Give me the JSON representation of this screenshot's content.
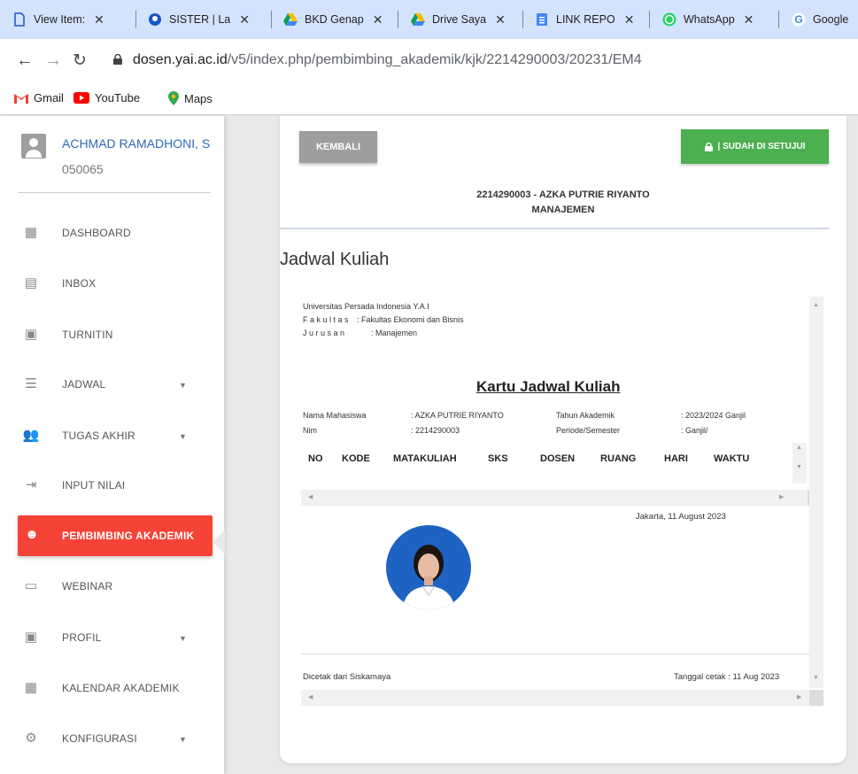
{
  "browser": {
    "tabs": [
      {
        "label": "View Item:",
        "icon": "document-icon"
      },
      {
        "label": "SISTER | La",
        "icon": "sister-icon"
      },
      {
        "label": "BKD Genap",
        "icon": "google-drive-icon"
      },
      {
        "label": "Drive Saya",
        "icon": "google-drive-icon"
      },
      {
        "label": "LINK REPO",
        "icon": "google-forms-icon"
      },
      {
        "label": "WhatsApp",
        "icon": "whatsapp-icon"
      },
      {
        "label": "Google",
        "icon": "google-icon"
      }
    ],
    "url_host": "dosen.yai.ac.id",
    "url_path": "/v5/index.php/pembimbing_akademik/kjk/2214290003/20231/EM4",
    "bookmarks": [
      {
        "label": "Gmail",
        "icon": "gmail-icon"
      },
      {
        "label": "YouTube",
        "icon": "youtube-icon"
      },
      {
        "label": "Maps",
        "icon": "maps-icon"
      }
    ]
  },
  "sidebar": {
    "user_name": "ACHMAD RAMADHONI, S",
    "user_id": "050065",
    "items": [
      {
        "label": "DASHBOARD",
        "icon": "dashboard-icon",
        "caret": false
      },
      {
        "label": "INBOX",
        "icon": "inbox-icon",
        "caret": false
      },
      {
        "label": "TURNITIN",
        "icon": "turnitin-icon",
        "caret": false
      },
      {
        "label": "JADWAL",
        "icon": "list-icon",
        "caret": true
      },
      {
        "label": "TUGAS AKHIR",
        "icon": "people-icon",
        "caret": true
      },
      {
        "label": "INPUT NILAI",
        "icon": "input-icon",
        "caret": false
      },
      {
        "label": "PEMBIMBING AKADEMIK",
        "icon": "face-icon",
        "caret": false,
        "active": true
      },
      {
        "label": "WEBINAR",
        "icon": "webinar-icon",
        "caret": false
      },
      {
        "label": "PROFIL",
        "icon": "profile-icon",
        "caret": true
      },
      {
        "label": "KALENDAR AKADEMIK",
        "icon": "calendar-icon",
        "caret": false
      },
      {
        "label": "KONFIGURASI",
        "icon": "gear-icon",
        "caret": true
      }
    ]
  },
  "main": {
    "back_label": "KEMBALI",
    "approved_label": "| SUDAH DI SETUJUI",
    "student_line": "2214290003 - AZKA PUTRIE RIYANTO",
    "major_line": "MANAJEMEN",
    "section_title": "Jadwal Kuliah",
    "doc": {
      "university": "Universitas Persada Indonesia Y.A.I",
      "fakultas_label": "F a k u l t a s",
      "fakultas_value": ": Fakultas Ekonomi dan Bisnis",
      "jurusan_label": "J u r u s a n",
      "jurusan_value": ": Manajemen",
      "heading": "Kartu Jadwal Kuliah",
      "nama_label": "Nama Mahasiswa",
      "nama_value": ": AZKA PUTRIE RIYANTO",
      "nim_label": "Nim",
      "nim_value": ": 2214290003",
      "tahun_label": "Tahun Akademik",
      "tahun_value": ": 2023/2024 Ganjil",
      "periode_label": "Periode/Semester",
      "periode_value": ": Ganjil/",
      "columns": [
        "NO",
        "KODE",
        "MATAKULIAH",
        "SKS",
        "DOSEN",
        "RUANG",
        "HARI",
        "WAKTU"
      ],
      "place_date": "Jakarta, 11 August 2023",
      "printed_from": "Dicetak dari Siskamaya",
      "print_date": "Tanggal cetak : 11 Aug 2023"
    }
  },
  "colors": {
    "active_menu": "#f44336",
    "approve_button": "#4caf50",
    "back_button": "#9e9e9e",
    "user_name": "#2a6bb5"
  }
}
